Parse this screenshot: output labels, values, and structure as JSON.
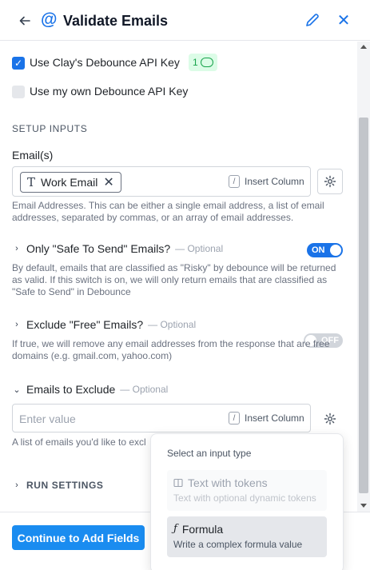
{
  "header": {
    "title": "Validate Emails",
    "back_icon": "arrow-left-icon",
    "title_icon": "at-sign-icon",
    "edit_icon": "pencil-icon",
    "close_icon": "close-icon"
  },
  "api_key": {
    "use_clay_label": "Use Clay's Debounce API Key",
    "use_clay_checked": true,
    "credit_count": "1",
    "use_own_label": "Use my own Debounce API Key",
    "use_own_checked": false
  },
  "setup_inputs": {
    "section_title": "SETUP INPUTS",
    "emails": {
      "label": "Email(s)",
      "chip_label": "Work Email",
      "insert_column_key": "/",
      "insert_column_label": "Insert Column",
      "help": "Email Addresses. This can be either a single email address, a list of email addresses, separated by commas, or an array of email addresses."
    },
    "safe_to_send": {
      "label": "Only \"Safe To Send\" Emails?",
      "optional": "— Optional",
      "toggle_label": "ON",
      "enabled": true,
      "help": "By default, emails that are classified as \"Risky\" by debounce will be returned as valid. If this switch is on, we will only return emails that are classified as \"Safe to Send\" in Debounce"
    },
    "exclude_free": {
      "label": "Exclude \"Free\" Emails?",
      "optional": "— Optional",
      "toggle_label": "OFF",
      "enabled": false,
      "help": "If true, we will remove any email addresses from the response that are free domains (e.g. gmail.com, yahoo.com)"
    },
    "emails_to_exclude": {
      "label": "Emails to Exclude",
      "optional": "— Optional",
      "placeholder": "Enter value",
      "insert_column_key": "/",
      "insert_column_label": "Insert Column",
      "help": "A list of emails you'd like to excl"
    }
  },
  "run_settings": {
    "label": "RUN SETTINGS"
  },
  "footer": {
    "primary_button": "Continue to Add Fields"
  },
  "input_type_popover": {
    "title": "Select an input type",
    "options": [
      {
        "name": "Text with tokens",
        "description": "Text with optional dynamic tokens",
        "icon": "book-icon",
        "disabled": true
      },
      {
        "name": "Formula",
        "description": "Write a complex formula value",
        "icon": "function-icon",
        "disabled": false
      }
    ]
  },
  "colors": {
    "accent": "#1a73e8",
    "primary_button": "#1a8cf0",
    "credit_badge_bg": "#dcfce7",
    "credit_badge_fg": "#16a34a"
  }
}
